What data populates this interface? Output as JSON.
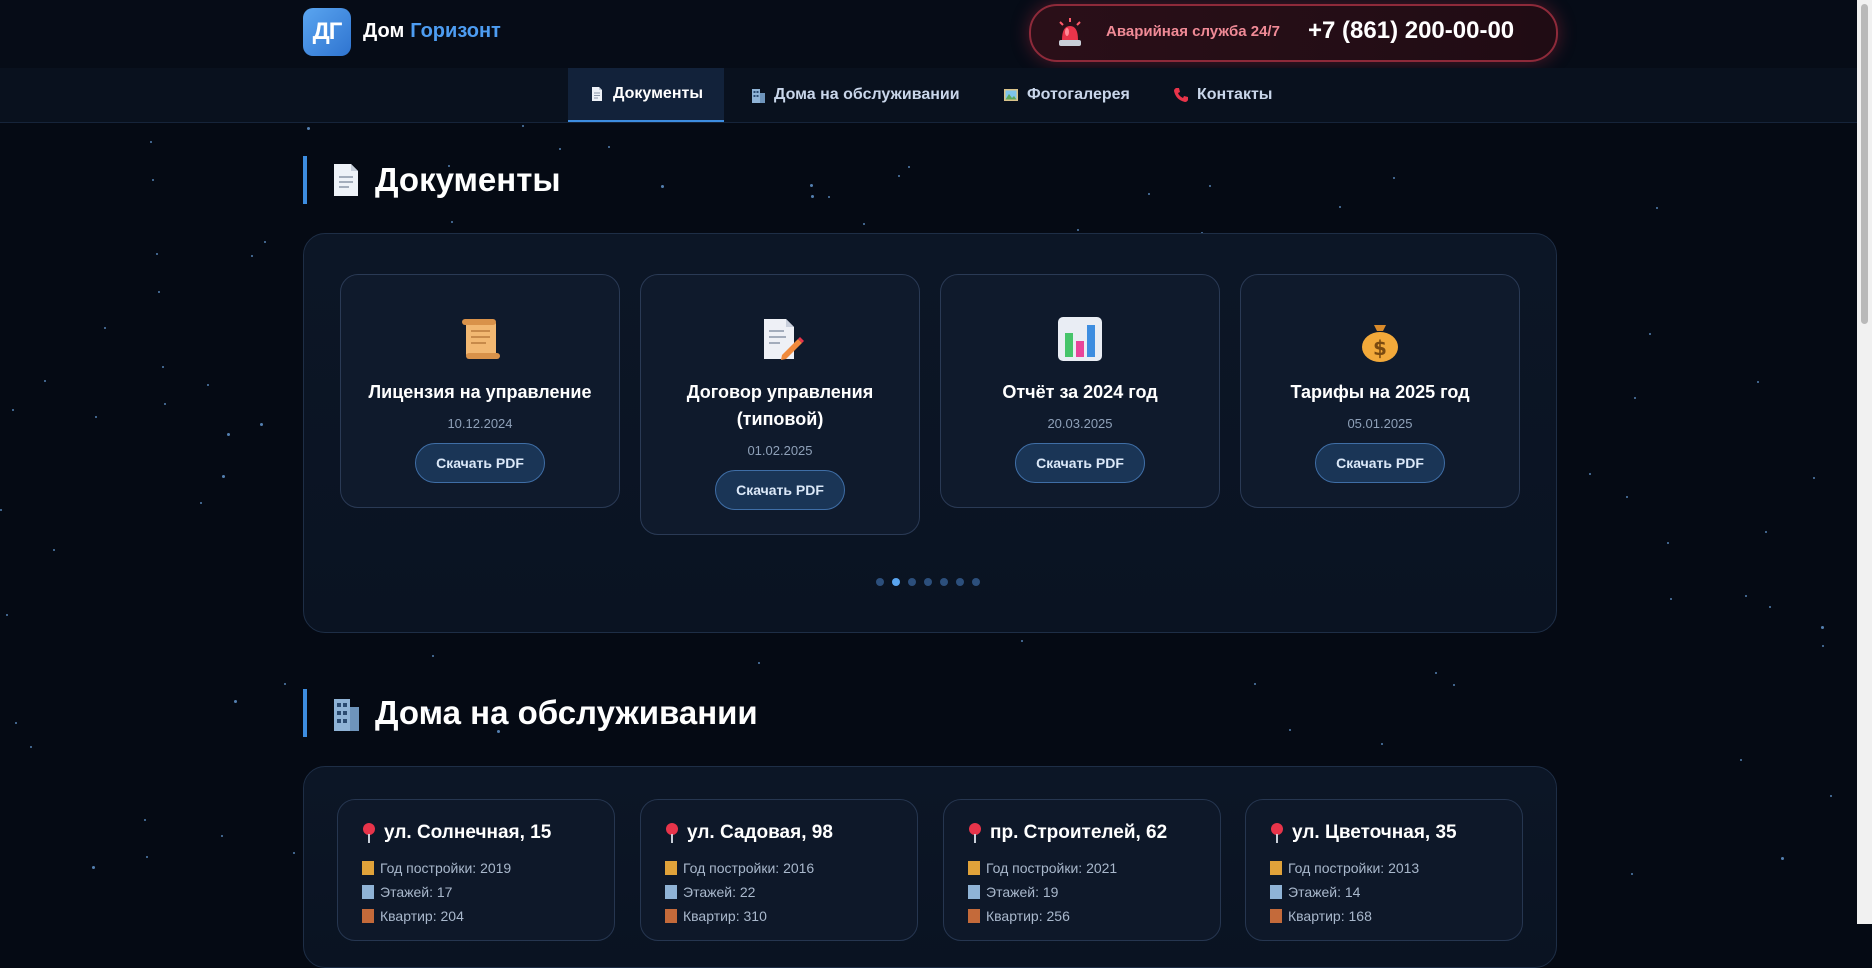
{
  "header": {
    "logo_text": "ДГ",
    "brand_first": "Дом",
    "brand_second": "Горизонт",
    "emergency_label": "Аварийная служба 24/7",
    "emergency_phone": "+7 (861) 200-00-00",
    "icon": "siren-icon"
  },
  "nav": {
    "items": [
      {
        "label": "Документы",
        "icon": "document-icon",
        "active": true
      },
      {
        "label": "Дома на обслуживании",
        "icon": "building-icon",
        "active": false
      },
      {
        "label": "Фотогалерея",
        "icon": "picture-icon",
        "active": false
      },
      {
        "label": "Контакты",
        "icon": "phone-icon",
        "active": false
      }
    ]
  },
  "documents": {
    "title": "Документы",
    "icon": "document-icon",
    "cards": [
      {
        "title": "Лицензия на управление",
        "date": "10.12.2024",
        "button": "Скачать PDF",
        "icon": "scroll-icon"
      },
      {
        "title": "Договор управления (типовой)",
        "date": "01.02.2025",
        "button": "Скачать PDF",
        "icon": "memo-icon"
      },
      {
        "title": "Отчёт за 2024 год",
        "date": "20.03.2025",
        "button": "Скачать PDF",
        "icon": "bar-chart-icon"
      },
      {
        "title": "Тарифы на 2025 год",
        "date": "05.01.2025",
        "button": "Скачать PDF",
        "icon": "money-bag-icon"
      }
    ],
    "dots_count": 7,
    "active_dot": 1
  },
  "houses": {
    "title": "Дома на обслуживании",
    "icon": "building-icon",
    "cards": [
      {
        "address": "ул. Солнечная, 15",
        "year": "Год постройки: 2019",
        "floors": "Этажей: 17",
        "flats": "Квартир: 204"
      },
      {
        "address": "ул. Садовая, 98",
        "year": "Год постройки: 2016",
        "floors": "Этажей: 22",
        "flats": "Квартир: 310"
      },
      {
        "address": "пр. Строителей, 62",
        "year": "Год постройки: 2021",
        "floors": "Этажей: 19",
        "flats": "Квартир: 256"
      },
      {
        "address": "ул. Цветочная, 35",
        "year": "Год постройки: 2013",
        "floors": "Этажей: 14",
        "flats": "Квартир: 168"
      }
    ]
  },
  "colors": {
    "accent": "#3d8de0",
    "background": "#050a14",
    "emergency": "#f08a96"
  }
}
